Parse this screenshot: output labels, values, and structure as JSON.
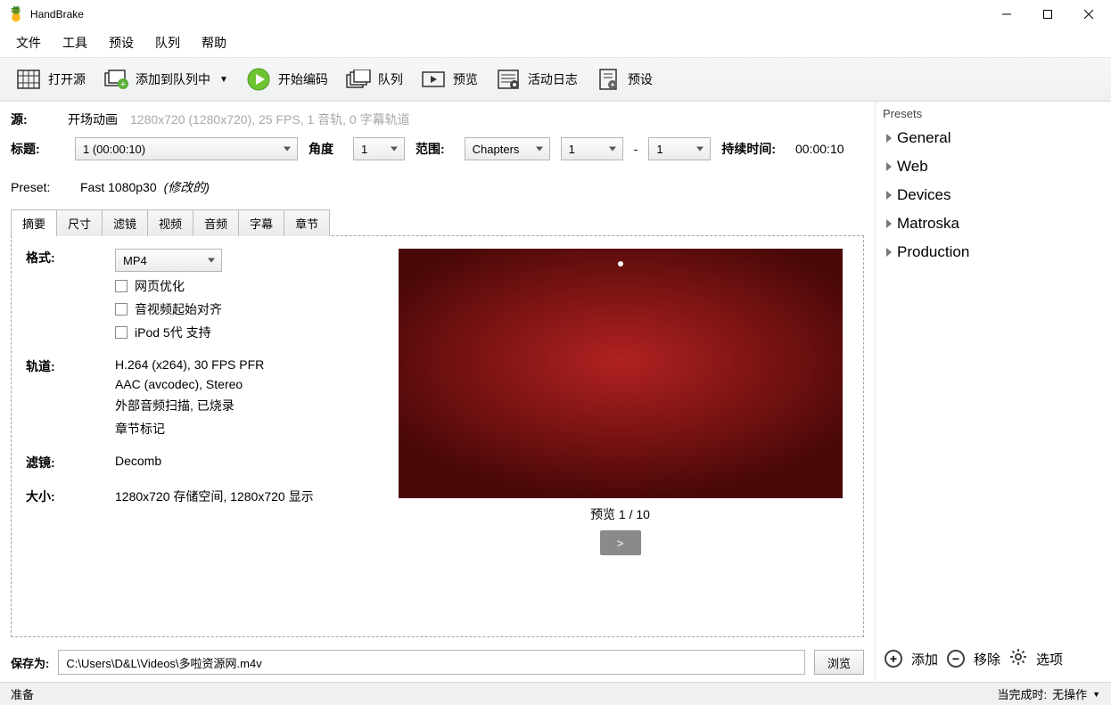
{
  "window": {
    "title": "HandBrake"
  },
  "menu": {
    "file": "文件",
    "tools": "工具",
    "presets": "预设",
    "queue": "队列",
    "help": "帮助"
  },
  "toolbar": {
    "open_source": "打开源",
    "add_to_queue": "添加到队列中",
    "start_encode": "开始编码",
    "queue": "队列",
    "preview": "预览",
    "activity_log": "活动日志",
    "presets": "预设"
  },
  "source": {
    "label": "源:",
    "name": "开场动画",
    "meta": "1280x720 (1280x720), 25 FPS, 1 音轨, 0 字幕轨道"
  },
  "title_row": {
    "title_label": "标题:",
    "title_value": "1  (00:00:10)",
    "angle_label": "角度",
    "angle_value": "1",
    "range_label": "范围:",
    "range_type": "Chapters",
    "range_from": "1",
    "range_dash": "-",
    "range_to": "1",
    "duration_label": "持续时间:",
    "duration_value": "00:00:10"
  },
  "preset_row": {
    "label": "Preset:",
    "name": "Fast 1080p30",
    "mod": "(修改的)"
  },
  "tabs": {
    "summary": "摘要",
    "dimensions": "尺寸",
    "filters": "滤镜",
    "video": "视频",
    "audio": "音频",
    "subtitles": "字幕",
    "chapters": "章节"
  },
  "summary": {
    "format_label": "格式:",
    "format_value": "MP4",
    "cb_web": "网页优化",
    "cb_avstart": "音视频起始对齐",
    "cb_ipod": "iPod 5代 支持",
    "tracks_label": "轨道:",
    "track1": "H.264 (x264), 30 FPS PFR",
    "track2": "AAC (avcodec), Stereo",
    "track3": "外部音频扫描, 已烧录",
    "track4": "章节标记",
    "filters_label": "滤镜:",
    "filters_value": "Decomb",
    "size_label": "大小:",
    "size_value": "1280x720 存储空间, 1280x720 显示",
    "preview_caption": "预览 1 / 10",
    "next": ">"
  },
  "saveas": {
    "label": "保存为:",
    "value": "C:\\Users\\D&L\\Videos\\多啦资源网.m4v",
    "browse": "浏览"
  },
  "presets_panel": {
    "heading": "Presets",
    "items": [
      "General",
      "Web",
      "Devices",
      "Matroska",
      "Production"
    ],
    "add": "添加",
    "remove": "移除",
    "options": "选项"
  },
  "status": {
    "ready": "准备",
    "when_done_label": "当完成时:",
    "when_done_value": "无操作"
  }
}
